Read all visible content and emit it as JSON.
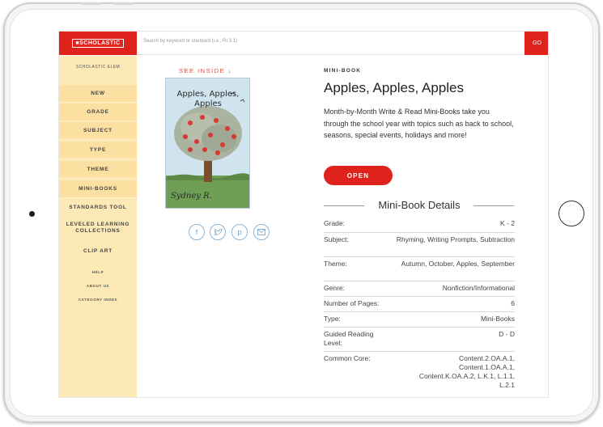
{
  "header": {
    "logo_text": "■SCHOLASTIC",
    "search_placeholder": "Search by keyword or standard (i.e., RI.3.1)",
    "go_label": "GO"
  },
  "sidebar": {
    "top_label": "SCHOLASTIC ELEM",
    "items": [
      "NEW",
      "GRADE",
      "SUBJECT",
      "TYPE",
      "THEME",
      "MINI-BOOKS",
      "STANDARDS TOOL",
      "LEVELED LEARNING COLLECTIONS",
      "CLIP ART"
    ],
    "footer_links": [
      "HELP",
      "ABOUT US",
      "CATEGORY INDEX"
    ]
  },
  "preview": {
    "see_inside": "SEE INSIDE ↓",
    "cover_title": "Apples, Apples, Apples",
    "cover_author": "Sydney R.",
    "share_icons": [
      "facebook-icon",
      "twitter-icon",
      "pinterest-icon",
      "email-icon"
    ]
  },
  "product": {
    "kicker": "MINI-BOOK",
    "title": "Apples, Apples, Apples",
    "description": "Month-by-Month Write & Read Mini-Books take you through the school year with topics such as back to school, seasons, special events, holidays and more!",
    "open_label": "OPEN",
    "details_heading": "Mini-Book Details",
    "details": [
      {
        "label": "Grade:",
        "value": "K - 2"
      },
      {
        "label": "Subject:",
        "value": "Rhyming, Writing Prompts, Subtraction"
      },
      {
        "label": "Theme:",
        "value": "Autumn, October, Apples, September"
      },
      {
        "label": "Genre:",
        "value": "Nonfiction/Informational"
      },
      {
        "label": "Number of Pages:",
        "value": "6"
      },
      {
        "label": "Type:",
        "value": "Mini-Books"
      },
      {
        "label": "Guided Reading Level:",
        "value": "D - D"
      },
      {
        "label": "Common Core:",
        "value": "Content.2.OA.A.1, Content.1.OA.A.1, Content.K.OA.A.2, L.K.1, L.1.1, L.2.1"
      }
    ]
  },
  "colors": {
    "brand_red": "#e0221d",
    "sidebar_bg": "#fde9b5",
    "accent_orange": "#e8463a"
  }
}
